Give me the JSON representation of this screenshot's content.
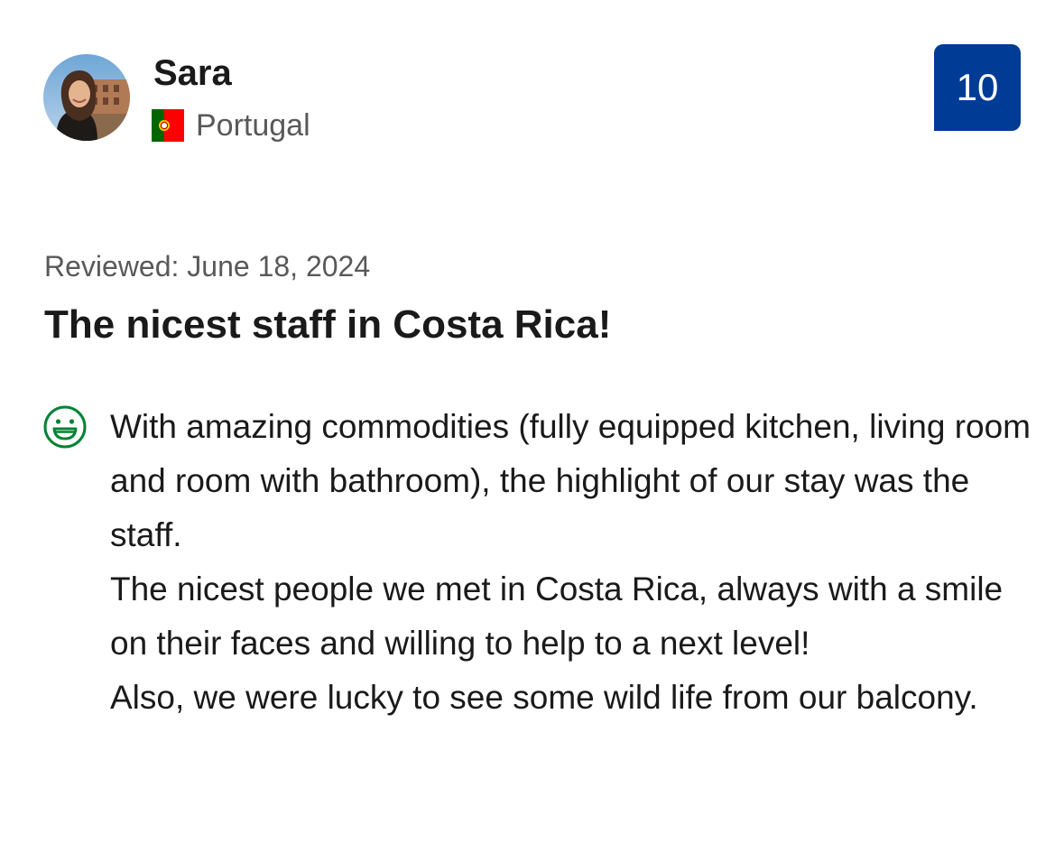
{
  "reviewer": {
    "name": "Sara",
    "country": "Portugal",
    "avatar_icon": "avatar-photo",
    "flag_icon": "portugal-flag-icon"
  },
  "score": {
    "value": "10",
    "badge_color": "#003b95"
  },
  "review": {
    "date_text": "Reviewed: June 18, 2024",
    "title": "The nicest staff in Costa Rica!",
    "positive_icon": "smile-icon",
    "positive_icon_color": "#008234",
    "paragraphs": [
      "With amazing commodities (fully equipped kitchen, living room and room with bathroom), the highlight of our stay was the staff.",
      "The nicest people we met in Costa Rica, always with a smile on their faces and willing to help to a next level!",
      "Also, we were lucky to see some wild life from our balcony."
    ]
  }
}
